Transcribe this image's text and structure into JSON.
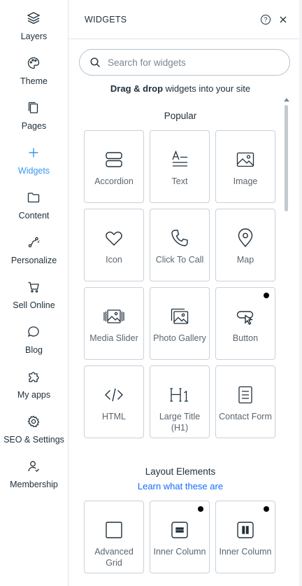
{
  "rail": {
    "items": [
      {
        "label": "Layers",
        "icon": "layers-icon"
      },
      {
        "label": "Theme",
        "icon": "palette-icon"
      },
      {
        "label": "Pages",
        "icon": "pages-icon"
      },
      {
        "label": "Widgets",
        "icon": "plus-icon",
        "active": true
      },
      {
        "label": "Content",
        "icon": "folder-icon"
      },
      {
        "label": "Personalize",
        "icon": "personalize-icon"
      },
      {
        "label": "Sell Online",
        "icon": "cart-icon"
      },
      {
        "label": "Blog",
        "icon": "chat-bubble-icon"
      },
      {
        "label": "My apps",
        "icon": "puzzle-icon"
      },
      {
        "label": "SEO & Settings",
        "icon": "gear-icon"
      },
      {
        "label": "Membership",
        "icon": "person-icon"
      }
    ]
  },
  "panel": {
    "title": "WIDGETS",
    "help_label": "?",
    "search_placeholder": "Search for widgets",
    "hint_bold": "Drag & drop",
    "hint_rest": " widgets into your site"
  },
  "popular": {
    "title": "Popular",
    "tiles": [
      {
        "label": "Accordion",
        "icon": "accordion-icon"
      },
      {
        "label": "Text",
        "icon": "text-icon"
      },
      {
        "label": "Image",
        "icon": "image-icon"
      },
      {
        "label": "Icon",
        "icon": "heart-icon"
      },
      {
        "label": "Click To Call",
        "icon": "phone-icon"
      },
      {
        "label": "Map",
        "icon": "map-pin-icon"
      },
      {
        "label": "Media Slider",
        "icon": "media-slider-icon"
      },
      {
        "label": "Photo Gallery",
        "icon": "gallery-icon"
      },
      {
        "label": "Button",
        "icon": "button-icon",
        "dot": true
      },
      {
        "label": "HTML",
        "icon": "code-icon"
      },
      {
        "label": "Large Title (H1)",
        "icon": "h1-icon"
      },
      {
        "label": "Contact Form",
        "icon": "form-icon"
      }
    ]
  },
  "layout": {
    "title": "Layout Elements",
    "link": "Learn what these are",
    "tiles": [
      {
        "label": "Advanced Grid",
        "icon": "grid-icon"
      },
      {
        "label": "Inner Column",
        "icon": "column-icon",
        "dot": true
      },
      {
        "label": "Inner Column",
        "icon": "column-pause-icon",
        "dot": true
      }
    ]
  },
  "colors": {
    "accent": "#3899ec",
    "link": "#116dff",
    "text": "#20303c"
  }
}
